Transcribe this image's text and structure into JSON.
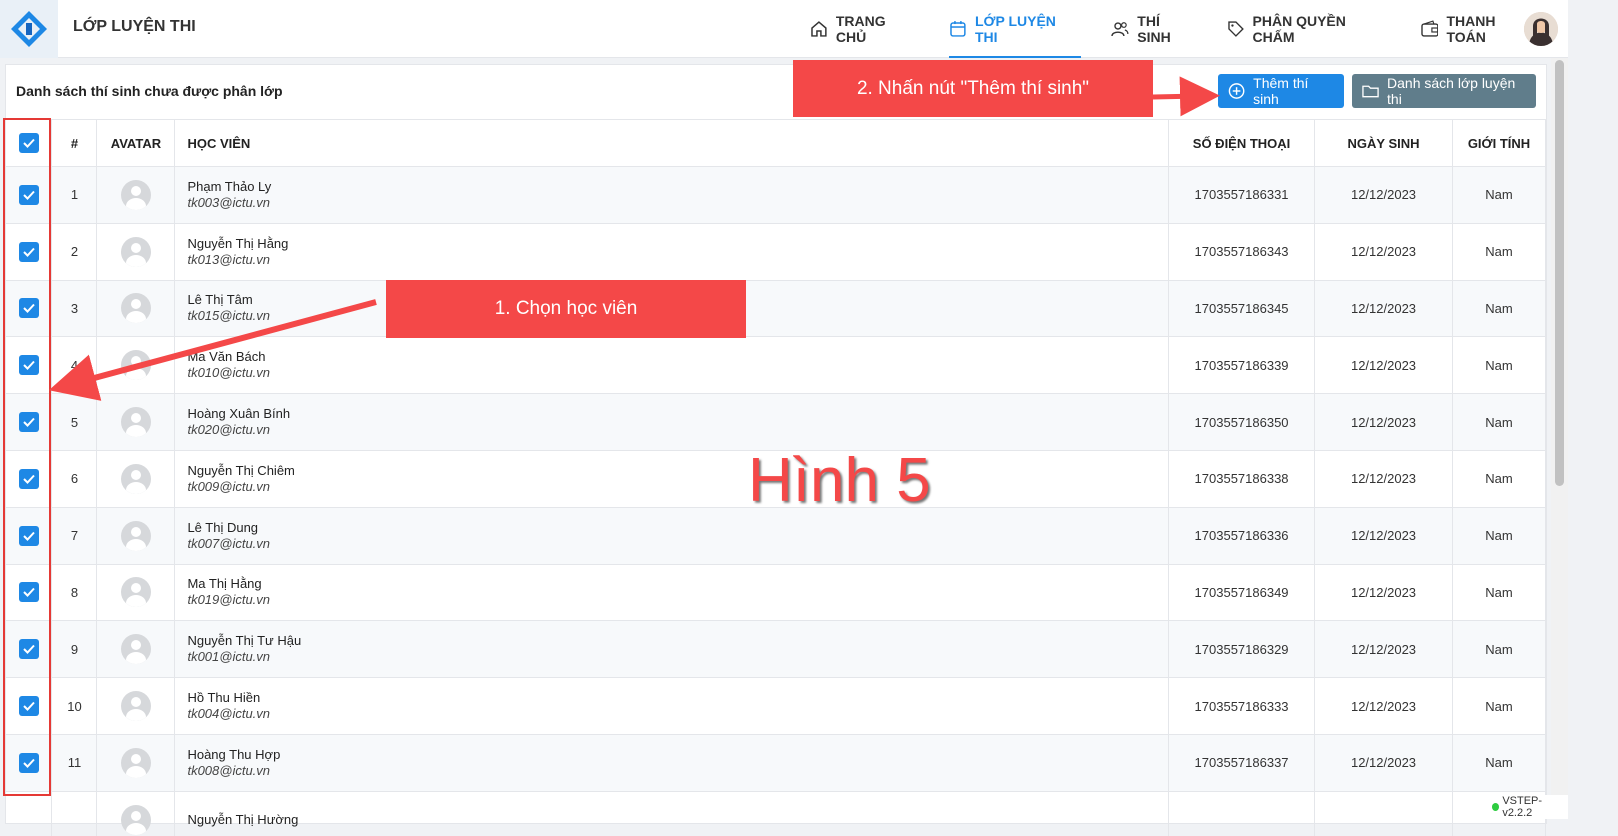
{
  "app": {
    "title": "LỚP LUYỆN THI"
  },
  "nav": [
    {
      "label": "TRANG CHỦ",
      "icon": "home-icon",
      "active": false
    },
    {
      "label": "LỚP LUYỆN THI",
      "icon": "calendar-icon",
      "active": true
    },
    {
      "label": "THÍ SINH",
      "icon": "users-icon",
      "active": false
    },
    {
      "label": "PHÂN QUYỀN CHẤM",
      "icon": "tag-icon",
      "active": false
    },
    {
      "label": "THANH TOÁN",
      "icon": "wallet-icon",
      "active": false
    }
  ],
  "panel": {
    "title": "Danh sách thí sinh chưa được phân lớp",
    "add_button": "Thêm thí sinh",
    "list_button": "Danh sách lớp luyện thi"
  },
  "table": {
    "headers": {
      "index": "#",
      "avatar": "AVATAR",
      "student": "HỌC VIÊN",
      "phone": "SỐ ĐIỆN THOẠI",
      "dob": "NGÀY SINH",
      "gender": "GIỚI TÍNH"
    },
    "rows": [
      {
        "no": "1",
        "name": "Phạm Thảo Ly",
        "email": "tk003@ictu.vn",
        "phone": "1703557186331",
        "dob": "12/12/2023",
        "gender": "Nam"
      },
      {
        "no": "2",
        "name": "Nguyễn Thị Hằng",
        "email": "tk013@ictu.vn",
        "phone": "1703557186343",
        "dob": "12/12/2023",
        "gender": "Nam"
      },
      {
        "no": "3",
        "name": "Lê Thị Tâm",
        "email": "tk015@ictu.vn",
        "phone": "1703557186345",
        "dob": "12/12/2023",
        "gender": "Nam"
      },
      {
        "no": "4",
        "name": "Ma Văn Bách",
        "email": "tk010@ictu.vn",
        "phone": "1703557186339",
        "dob": "12/12/2023",
        "gender": "Nam"
      },
      {
        "no": "5",
        "name": "Hoàng Xuân Bính",
        "email": "tk020@ictu.vn",
        "phone": "1703557186350",
        "dob": "12/12/2023",
        "gender": "Nam"
      },
      {
        "no": "6",
        "name": "Nguyễn Thị Chiêm",
        "email": "tk009@ictu.vn",
        "phone": "1703557186338",
        "dob": "12/12/2023",
        "gender": "Nam"
      },
      {
        "no": "7",
        "name": "Lê Thị Dung",
        "email": "tk007@ictu.vn",
        "phone": "1703557186336",
        "dob": "12/12/2023",
        "gender": "Nam"
      },
      {
        "no": "8",
        "name": "Ma Thị Hằng",
        "email": "tk019@ictu.vn",
        "phone": "1703557186349",
        "dob": "12/12/2023",
        "gender": "Nam"
      },
      {
        "no": "9",
        "name": "Nguyễn Thị Tư Hậu",
        "email": "tk001@ictu.vn",
        "phone": "1703557186329",
        "dob": "12/12/2023",
        "gender": "Nam"
      },
      {
        "no": "10",
        "name": "Hồ Thu Hiền",
        "email": "tk004@ictu.vn",
        "phone": "1703557186333",
        "dob": "12/12/2023",
        "gender": "Nam"
      },
      {
        "no": "11",
        "name": "Hoàng Thu Hợp",
        "email": "tk008@ictu.vn",
        "phone": "1703557186337",
        "dob": "12/12/2023",
        "gender": "Nam"
      },
      {
        "no": "",
        "name": "Nguyễn Thị Hường",
        "email": "",
        "phone": "",
        "dob": "",
        "gender": ""
      }
    ]
  },
  "annotations": {
    "step1": "1. Chọn học viên",
    "step2": "2. Nhấn nút \"Thêm thí sinh\"",
    "figure": "Hình 5",
    "color": "#f44848"
  },
  "version": "VSTEP-v2.2.2",
  "colors": {
    "primary": "#1e88e5",
    "secondary": "#607d8b"
  }
}
